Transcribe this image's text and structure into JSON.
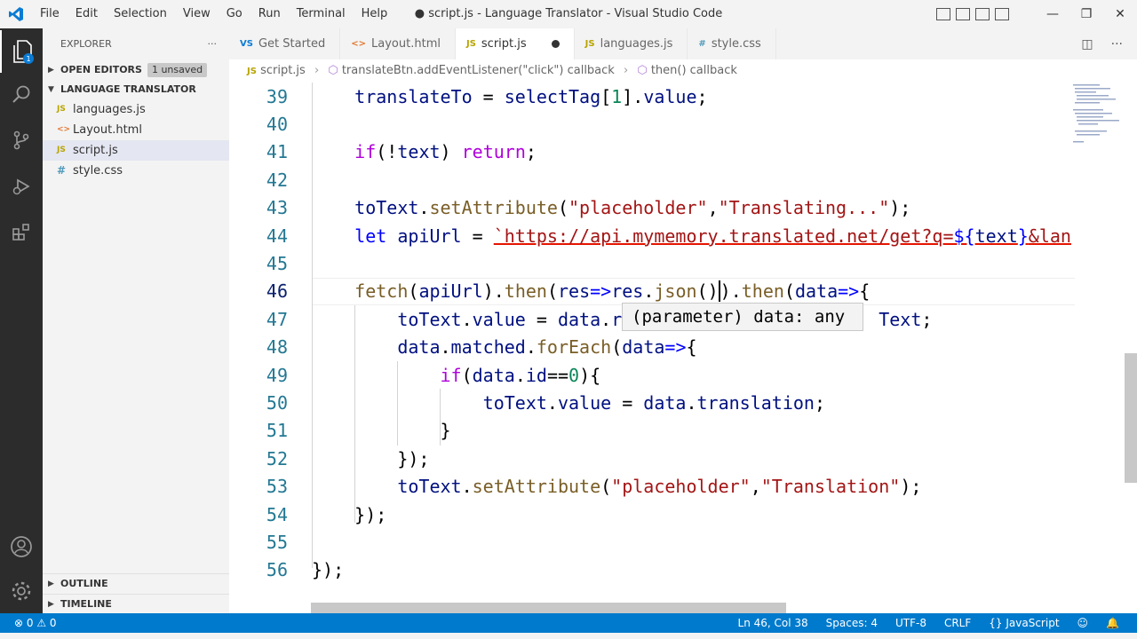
{
  "titlebar": {
    "menu": [
      "File",
      "Edit",
      "Selection",
      "View",
      "Go",
      "Run",
      "Terminal",
      "Help"
    ],
    "title": "● script.js - Language Translator - Visual Studio Code"
  },
  "activity": [
    "explorer-icon",
    "search-icon",
    "source-control-icon",
    "run-debug-icon",
    "extensions-icon",
    "account-icon",
    "settings-gear-icon"
  ],
  "sidebar": {
    "header": "EXPLORER",
    "open_editors": "OPEN EDITORS",
    "unsaved_badge": "1 unsaved",
    "folder": "LANGUAGE TRANSLATOR",
    "files": [
      {
        "icon": "JS",
        "name": "languages.js"
      },
      {
        "icon": "<>",
        "name": "Layout.html"
      },
      {
        "icon": "JS",
        "name": "script.js"
      },
      {
        "icon": "#",
        "name": "style.css"
      }
    ],
    "outline": "OUTLINE",
    "timeline": "TIMELINE"
  },
  "tabs": [
    {
      "icon": "VS",
      "label": "Get Started"
    },
    {
      "icon": "<>",
      "label": "Layout.html"
    },
    {
      "icon": "JS",
      "label": "script.js"
    },
    {
      "icon": "JS",
      "label": "languages.js"
    },
    {
      "icon": "#",
      "label": "style.css"
    }
  ],
  "breadcrumb": {
    "file_icon": "JS",
    "file": "script.js",
    "callback1": "translateBtn.addEventListener(\"click\") callback",
    "callback2": "then() callback"
  },
  "editor": {
    "line_numbers": [
      "39",
      "40",
      "41",
      "42",
      "43",
      "44",
      "45",
      "46",
      "47",
      "48",
      "49",
      "50",
      "51",
      "52",
      "53",
      "54",
      "55",
      "56"
    ],
    "hover_text": "(parameter) data: any"
  },
  "statusbar": {
    "problems": "⊗ 0 ⚠ 0",
    "position": "Ln 46, Col 38",
    "spaces": "Spaces: 4",
    "encoding": "UTF-8",
    "eol": "CRLF",
    "language": "{} JavaScript"
  },
  "colors": {
    "accent": "#007acc",
    "activitybar": "#2c2c2c"
  }
}
